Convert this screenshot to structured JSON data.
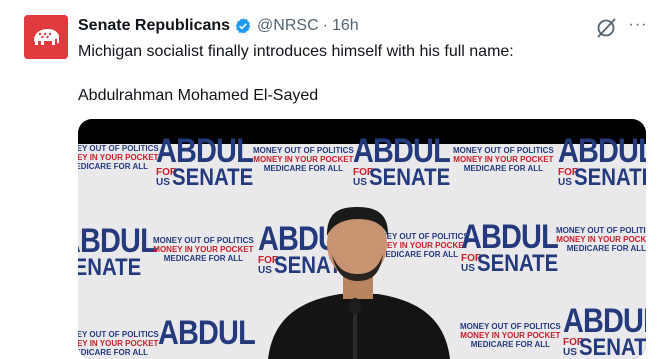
{
  "author": {
    "display_name": "Senate Republicans",
    "handle": "@NRSC",
    "separator": "·",
    "timestamp": "16h",
    "avatar_icon": "elephant-icon",
    "verified_icon": "verified-badge-icon"
  },
  "post": {
    "line1": "Michigan socialist finally introduces himself with his full name:",
    "line2": "Abdulrahman Mohamed El-Sayed"
  },
  "actions": {
    "grok_icon": "grok-icon",
    "more_label": "···"
  },
  "banner": {
    "name": "ABDUL",
    "for": "FOR",
    "us": "US",
    "senate": "SENATE",
    "slogan1": "MONEY OUT OF POLITICS",
    "slogan2": "MONEY IN YOUR POCKET",
    "slogan3": "MEDICARE FOR ALL"
  },
  "colors": {
    "brand_red": "#e0393e",
    "verified_blue": "#1d9bf0",
    "banner_navy": "#253a7c",
    "banner_red": "#c8202b",
    "muted_text": "#536471"
  }
}
